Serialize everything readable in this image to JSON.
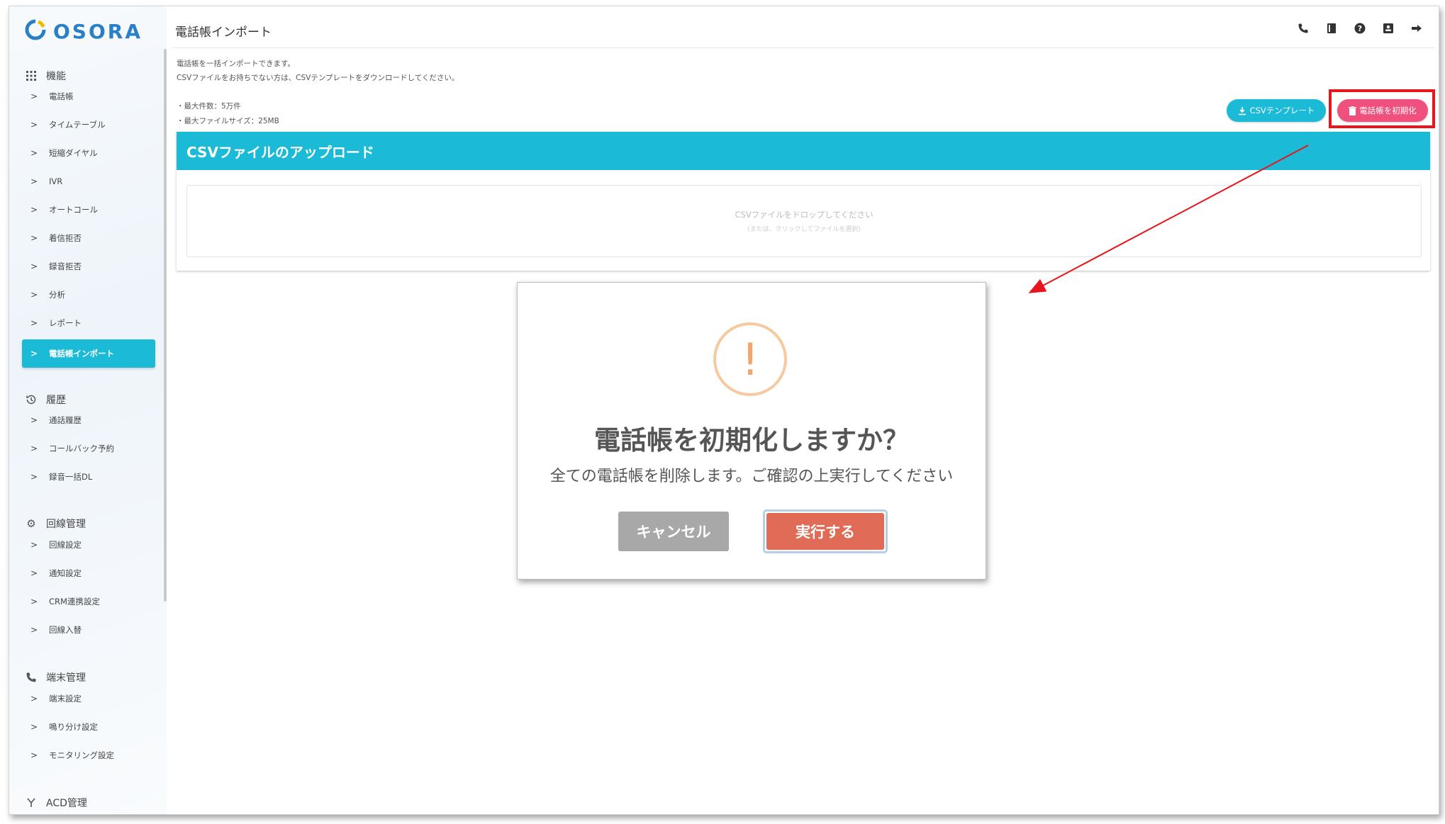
{
  "app": {
    "logo_text": "OSORA",
    "page_title": "電話帳インポート"
  },
  "sidebar": {
    "sections": [
      {
        "title": "機能",
        "icon": "grid-icon",
        "items": [
          "電話帳",
          "タイムテーブル",
          "短縮ダイヤル",
          "IVR",
          "オートコール",
          "着信拒否",
          "録音拒否",
          "分析",
          "レポート",
          "電話帳インポート"
        ]
      },
      {
        "title": "履歴",
        "icon": "history-icon",
        "items": [
          "通話履歴",
          "コールバック予約",
          "録音一括DL"
        ]
      },
      {
        "title": "回線管理",
        "icon": "gear-icon",
        "items": [
          "回線設定",
          "通知設定",
          "CRM連携設定",
          "回線入替"
        ]
      },
      {
        "title": "端末管理",
        "icon": "phone-icon",
        "items": [
          "端末設定",
          "鳴り分け設定",
          "モニタリング設定"
        ]
      },
      {
        "title": "ACD管理",
        "icon": "acd-icon",
        "items": []
      }
    ],
    "active_item": "電話帳インポート"
  },
  "header": {
    "icons": [
      "phone-icon",
      "book-icon",
      "help-icon",
      "user-card-icon",
      "logout-icon"
    ]
  },
  "content": {
    "desc_line1": "電話帳を一括インポートできます。",
    "desc_line2": "CSVファイルをお持ちでない方は、CSVテンプレートをダウンロードしてください。",
    "limit_count": "・最大件数：5万件",
    "limit_size": "・最大ファイルサイズ：25MB",
    "template_button": "CSVテンプレート",
    "reset_button": "電話帳を初期化",
    "upload_title": "CSVファイルのアップロード",
    "dropzone_main": "CSVファイルをドロップしてください",
    "dropzone_sub": "(または、クリックしてファイルを選択)"
  },
  "modal": {
    "icon": "!",
    "title": "電話帳を初期化しますか？",
    "message": "全ての電話帳を削除します。ご確認の上実行してください",
    "cancel_label": "キャンセル",
    "confirm_label": "実行する"
  },
  "colors": {
    "accent": "#1bbad6",
    "reset": "#f0507e",
    "confirm": "#e06b56",
    "cancel": "#a8a8a8",
    "annotation": "#e8151c",
    "logo": "#2a7fc6"
  }
}
